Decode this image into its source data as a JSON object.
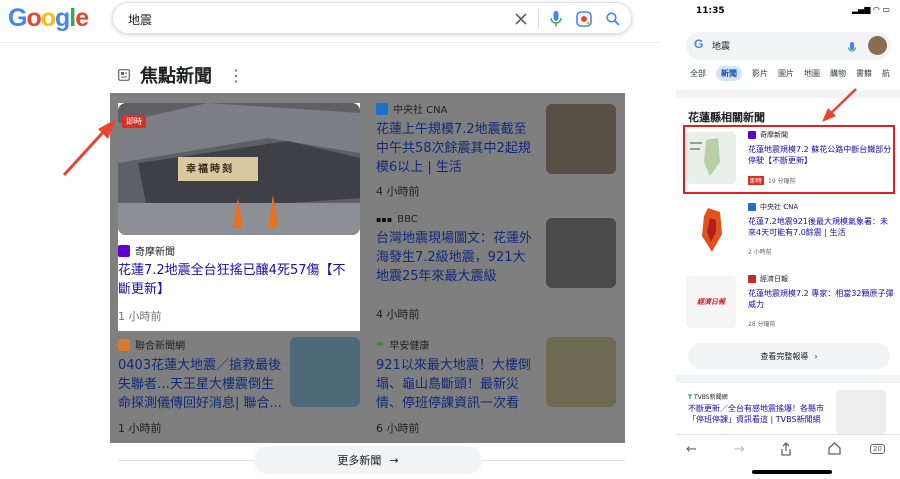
{
  "desktop": {
    "logo": [
      "G",
      "o",
      "o",
      "g",
      "l",
      "e"
    ],
    "logo_colors": [
      "#4285f4",
      "#ea4335",
      "#fbbc05",
      "#4285f4",
      "#34a853",
      "#ea4335"
    ],
    "search_query": "地震",
    "section_title": "焦點新聞",
    "featured": {
      "tag": "即時",
      "sign_text": "幸福時刻",
      "source": "奇摩新聞",
      "title": "花蓮7.2地震全台狂搖已釀4死57傷【不斷更新】",
      "time": "1 小時前"
    },
    "stories": [
      {
        "source": "中央社 CNA",
        "title": "花蓮上午規模7.2地震截至中午共58次餘震其中2起規模6以上 | 生活",
        "time": "4 小時前"
      },
      {
        "source": "BBC",
        "title": "台灣地震現場圖文：花蓮外海發生7.2級地震，921大地震25年來最大震級",
        "time": "4 小時前"
      },
      {
        "source": "聯合新聞網",
        "title": "0403花蓮大地震／搶救最後失聯者…天王星大樓震倒生命探測儀傳回好消息| 聯合...",
        "time": "1 小時前"
      },
      {
        "source": "早安健康",
        "title": "921以來最大地震！大樓倒塌、龜山島斷頭！最新災情、停班停課資訊一次看",
        "time": "6 小時前"
      }
    ],
    "more_news": "更多新聞"
  },
  "phone": {
    "time": "11:35",
    "search_query": "地震",
    "tabs": [
      "全部",
      "新聞",
      "影片",
      "圖片",
      "地圖",
      "購物",
      "書籍",
      "航"
    ],
    "selected_tab": "新聞",
    "section_title": "花蓮縣相關新聞",
    "items": [
      {
        "source": "奇摩新聞",
        "title": "花蓮地震規模7.2 蘇花公路中斷台鐵部分停駛【不斷更新】",
        "tag": "即時",
        "time": "19 分鐘前"
      },
      {
        "source": "中央社 CNA",
        "title": "花蓮7.2地震921後最大規模氣象署：未來4天可能有7.0餘震 | 生活",
        "time": "2 小時前"
      },
      {
        "source": "經濟日報",
        "title": "花蓮地震規模7.2 專家：相當32顆原子彈威力",
        "time": "28 分鐘前",
        "logo_text": "經濟日報"
      }
    ],
    "see_all": "查看完整報導",
    "last_item": {
      "source": "TVBS新聞網",
      "title": "不斷更新／全台有感地震搖爆！各縣市「停班停課」資訊看這 | TVBS新聞網"
    },
    "nav_tabs_count": "20"
  },
  "colors": {
    "highlight_red": "#e02020",
    "link_blue": "#1a0dab",
    "dim_overlay": "#7f7f7f"
  }
}
